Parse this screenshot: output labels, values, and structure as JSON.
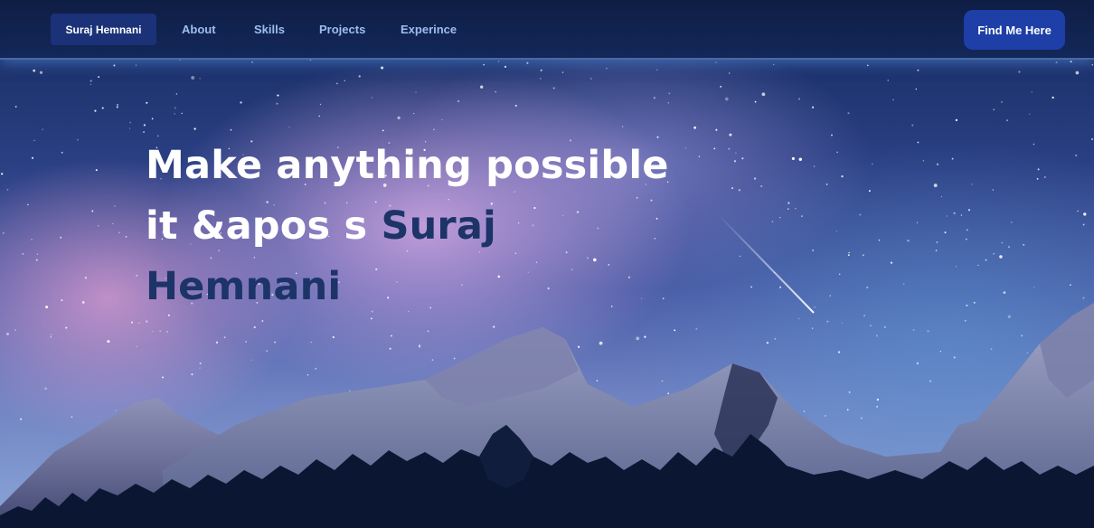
{
  "navbar": {
    "brand": "Suraj Hemnani",
    "links": [
      "About",
      "Skills",
      "Projects",
      "Experince"
    ],
    "cta_label": "Find Me Here"
  },
  "hero": {
    "headline_line1": "Make anything possible",
    "headline_prefix": "it &apos s ",
    "name_first": "Suraj",
    "name_last": "Hemnani"
  },
  "colors": {
    "nav_bg": "#0e1d44",
    "brand_bg": "#1b3278",
    "cta_bg": "#1e3fa8",
    "link_color": "#9dbdf0",
    "accent_text": "#1c3468"
  }
}
